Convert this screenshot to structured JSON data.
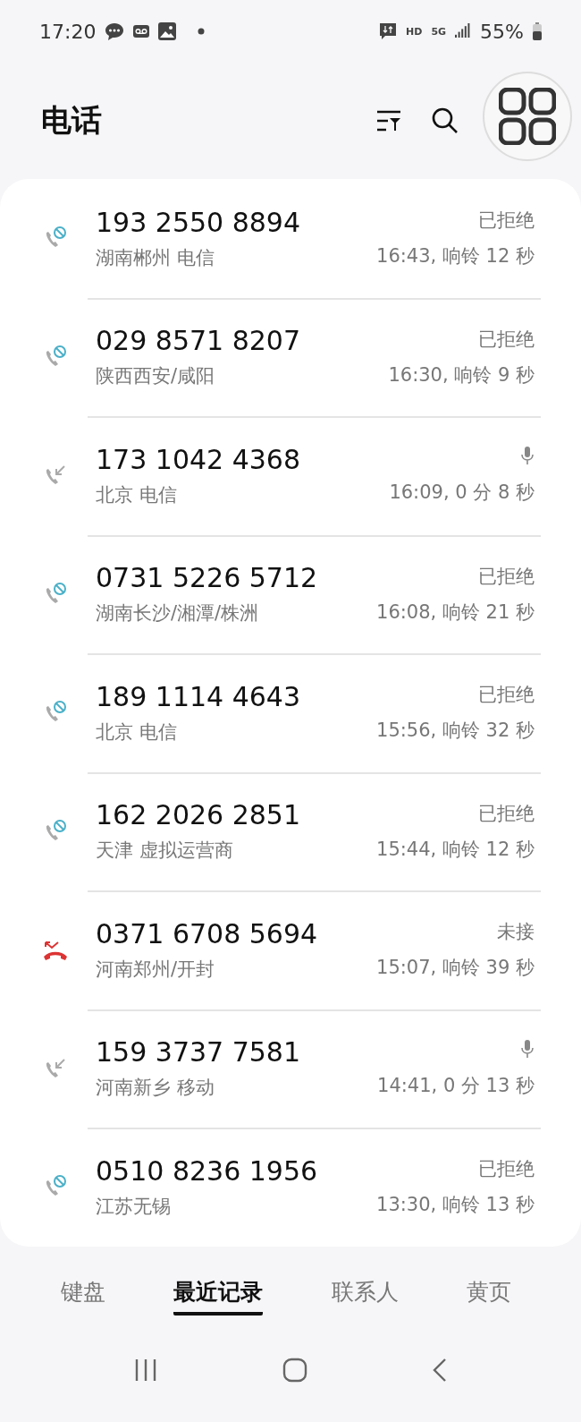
{
  "status_bar": {
    "time": "17:20",
    "network_badges": [
      "HD",
      "5G"
    ],
    "battery": "55%"
  },
  "header": {
    "title": "电话"
  },
  "calls": [
    {
      "kind": "rejected",
      "number": "193 2550 8894",
      "location": "湖南郴州 电信",
      "status": "已拒绝",
      "recorded": false,
      "time": "16:43, 响铃 12 秒"
    },
    {
      "kind": "rejected",
      "number": "029 8571 8207",
      "location": "陕西西安/咸阳",
      "status": "已拒绝",
      "recorded": false,
      "time": "16:30, 响铃 9 秒"
    },
    {
      "kind": "incoming",
      "number": "173 1042 4368",
      "location": "北京 电信",
      "recorded": true,
      "time": "16:09, 0 分 8 秒"
    },
    {
      "kind": "rejected",
      "number": "0731 5226 5712",
      "location": "湖南长沙/湘潭/株洲",
      "status": "已拒绝",
      "recorded": false,
      "time": "16:08, 响铃 21 秒"
    },
    {
      "kind": "rejected",
      "number": "189 1114 4643",
      "location": "北京 电信",
      "status": "已拒绝",
      "recorded": false,
      "time": "15:56, 响铃 32 秒"
    },
    {
      "kind": "rejected",
      "number": "162 2026 2851",
      "location": "天津 虚拟运营商",
      "status": "已拒绝",
      "recorded": false,
      "time": "15:44, 响铃 12 秒"
    },
    {
      "kind": "missed",
      "number": "0371 6708 5694",
      "location": "河南郑州/开封",
      "status": "未接",
      "recorded": false,
      "time": "15:07, 响铃 39 秒"
    },
    {
      "kind": "incoming",
      "number": "159 3737 7581",
      "location": "河南新乡 移动",
      "recorded": true,
      "time": "14:41, 0 分 13 秒"
    },
    {
      "kind": "rejected",
      "number": "0510 8236 1956",
      "location": "江苏无锡",
      "status": "已拒绝",
      "recorded": false,
      "time": "13:30, 响铃 13 秒"
    }
  ],
  "tabs": [
    {
      "label": "键盘",
      "selected": false
    },
    {
      "label": "最近记录",
      "selected": true
    },
    {
      "label": "联系人",
      "selected": false
    },
    {
      "label": "黄页",
      "selected": false
    }
  ]
}
